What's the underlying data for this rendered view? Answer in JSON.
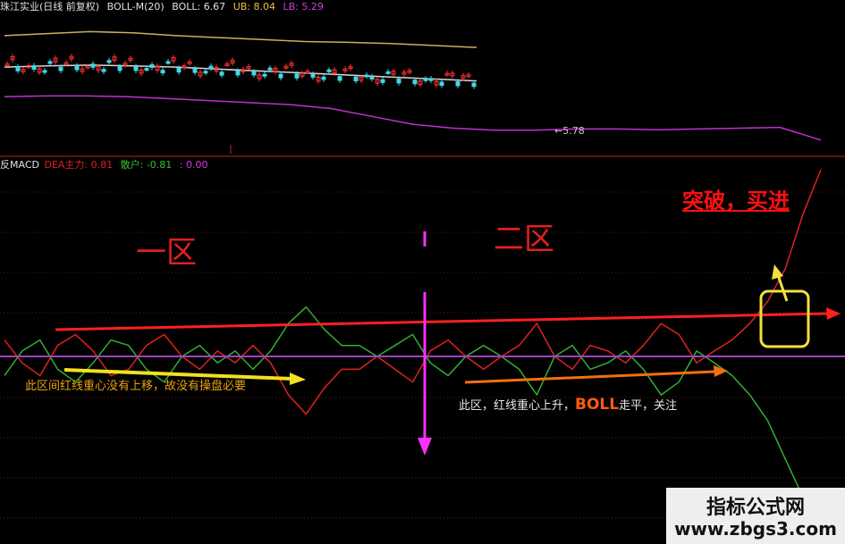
{
  "main_header": {
    "stock": "珠江实业(日线 前复权)",
    "indicator": "BOLL-M(20)",
    "boll": "BOLL: 6.67",
    "ub": "UB: 8.04",
    "lb": "LB: 5.29"
  },
  "macd_header": {
    "name": "反MACD",
    "dea": "DEA主力: 0.81",
    "diff": "散户: -0.81",
    "macd": ": 0.00"
  },
  "price_marker": "←5.78",
  "annotations": {
    "zone1": "一区",
    "zone2": "二区",
    "breakout": "突破，买进",
    "note1": "此区间红线重心没有上移，故没有操盘必要",
    "note2_pre": "此区，红线重心上升，",
    "note2_boll": "BOLL",
    "note2_post": "走平，关注"
  },
  "watermark": {
    "title": "指标公式网",
    "url": "www.zbgs3.com"
  },
  "colors": {
    "background": "#000000",
    "upper_band": "#c8b060",
    "mid_band": "#d8d8d8",
    "lower_band": "#c030d0",
    "main_force": "#e02020",
    "retail": "#30b030",
    "zero_line": "#a040c0",
    "candle_up": "#ff3030",
    "candle_down": "#40d8e8",
    "arrow_red": "#ff2020",
    "arrow_yellow": "#f0e020",
    "arrow_orange": "#f07010",
    "divider": "#ff30ff",
    "highlight_box": "#f0e040"
  },
  "chart_data": [
    {
      "type": "line",
      "title": "BOLL-M(20)",
      "x": [
        0,
        1,
        2,
        3,
        4,
        5,
        6,
        7,
        8,
        9,
        10,
        11,
        12,
        13,
        14,
        15,
        16,
        17,
        18,
        19,
        20
      ],
      "series": [
        {
          "name": "UB",
          "values": [
            8.15,
            8.2,
            8.25,
            8.22,
            8.15,
            8.1,
            8.05,
            8.0,
            7.98,
            7.95,
            7.9,
            7.85
          ]
        },
        {
          "name": "BOLL",
          "values": [
            7.35,
            7.38,
            7.4,
            7.38,
            7.35,
            7.3,
            7.25,
            7.2,
            7.15,
            7.1,
            7.05,
            7.0
          ]
        },
        {
          "name": "LB",
          "values": [
            6.6,
            6.62,
            6.62,
            6.6,
            6.55,
            6.5,
            6.45,
            6.4,
            6.3,
            6.1,
            5.9,
            5.8,
            5.75,
            5.75,
            5.78,
            5.78,
            5.76,
            5.78,
            5.8,
            5.82,
            5.5
          ]
        }
      ]
    },
    {
      "type": "line",
      "title": "反MACD",
      "x": [
        0,
        1,
        2,
        3,
        4,
        5,
        6,
        7,
        8,
        9,
        10,
        11,
        12,
        13,
        14,
        15,
        16,
        17,
        18,
        19,
        20,
        21,
        22,
        23,
        24,
        25,
        26,
        27,
        28,
        29,
        30,
        31,
        32,
        33,
        34,
        35,
        36,
        37,
        38,
        39,
        40,
        41,
        42,
        43,
        44,
        45,
        46
      ],
      "ylim": [
        -1.4,
        1.7
      ],
      "series": [
        {
          "name": "DEA主力",
          "values": [
            0.15,
            -0.05,
            -0.15,
            0.1,
            0.2,
            0.05,
            -0.15,
            -0.1,
            0.1,
            0.2,
            0.0,
            -0.1,
            0.05,
            -0.05,
            0.1,
            -0.05,
            -0.3,
            -0.45,
            -0.25,
            -0.1,
            -0.1,
            0.0,
            -0.1,
            -0.2,
            0.05,
            0.15,
            0.0,
            -0.1,
            0.0,
            0.1,
            0.3,
            0.0,
            -0.1,
            0.1,
            0.05,
            -0.05,
            0.1,
            0.3,
            0.2,
            -0.05,
            0.05,
            0.15,
            0.3,
            0.5,
            0.8,
            1.3,
            1.7
          ]
        },
        {
          "name": "散户",
          "values": [
            -0.15,
            0.05,
            0.15,
            -0.1,
            -0.2,
            -0.05,
            0.15,
            0.1,
            -0.1,
            -0.2,
            0.0,
            0.1,
            -0.05,
            0.05,
            -0.1,
            0.05,
            0.3,
            0.45,
            0.25,
            0.1,
            0.1,
            0.0,
            0.1,
            0.2,
            -0.05,
            -0.15,
            0.0,
            0.1,
            0.0,
            -0.1,
            -0.3,
            0.0,
            0.1,
            -0.1,
            -0.05,
            0.05,
            -0.1,
            -0.3,
            -0.2,
            0.05,
            -0.05,
            -0.15,
            -0.3,
            -0.5,
            -0.8,
            -1.1,
            -1.3
          ]
        }
      ]
    }
  ]
}
